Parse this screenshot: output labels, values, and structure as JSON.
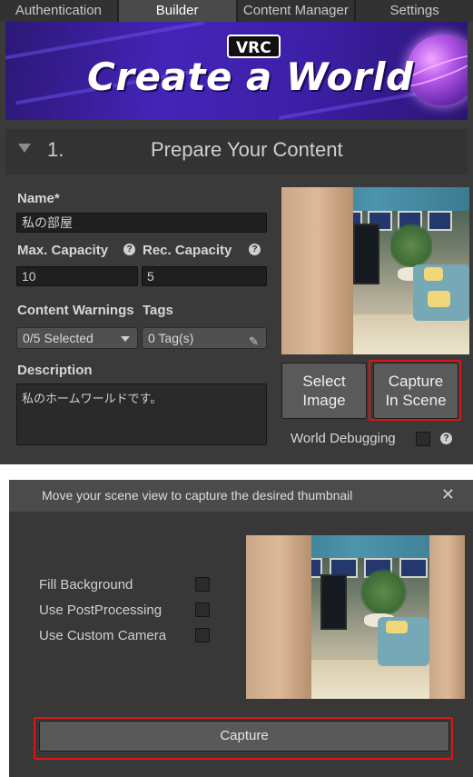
{
  "tabs": [
    "Authentication",
    "Builder",
    "Content Manager",
    "Settings"
  ],
  "active_tab": "Builder",
  "banner": {
    "badge": "VRC",
    "title": "Create a World"
  },
  "section": {
    "number": "1.",
    "title": "Prepare Your Content"
  },
  "form": {
    "name_label": "Name*",
    "name_value": "私の部屋",
    "max_capacity_label": "Max. Capacity",
    "max_capacity_value": "10",
    "rec_capacity_label": "Rec. Capacity",
    "rec_capacity_value": "5",
    "content_warnings_label": "Content Warnings",
    "content_warnings_value": "0/5 Selected",
    "tags_label": "Tags",
    "tags_value": "0 Tag(s)",
    "description_label": "Description",
    "description_value": "私のホームワールドです。",
    "help_glyph": "?"
  },
  "thumbnail": {
    "select_image_label_line1": "Select",
    "select_image_label_line2": "Image",
    "capture_label_line1": "Capture",
    "capture_label_line2": "In Scene",
    "world_debugging_label": "World Debugging"
  },
  "dialog": {
    "title": "Move your scene view to capture the desired thumbnail",
    "close_glyph": "✕",
    "options": [
      {
        "label": "Fill Background",
        "checked": false
      },
      {
        "label": "Use PostProcessing",
        "checked": false
      },
      {
        "label": "Use Custom Camera",
        "checked": false
      }
    ],
    "capture_button": "Capture"
  },
  "colors": {
    "panel_bg": "#3a3a3a",
    "banner_purple": "#4424b8",
    "highlight_red": "#e01414"
  }
}
